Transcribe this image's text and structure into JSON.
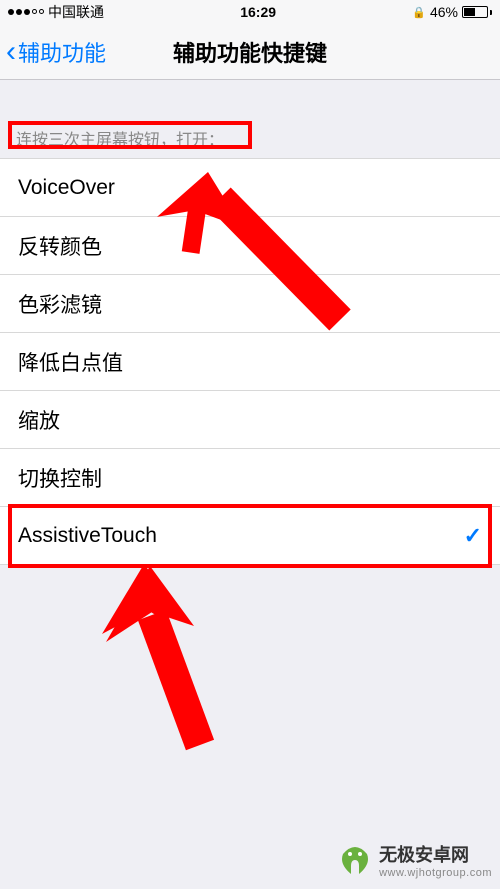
{
  "status_bar": {
    "carrier": "中国联通",
    "time": "16:29",
    "battery_pct": "46%"
  },
  "nav": {
    "back_label": "辅助功能",
    "title": "辅助功能快捷键"
  },
  "section_header": "连按三次主屏幕按钮，打开：",
  "items": [
    {
      "label": "VoiceOver",
      "checked": false
    },
    {
      "label": "反转颜色",
      "checked": false
    },
    {
      "label": "色彩滤镜",
      "checked": false
    },
    {
      "label": "降低白点值",
      "checked": false
    },
    {
      "label": "缩放",
      "checked": false
    },
    {
      "label": "切换控制",
      "checked": false
    },
    {
      "label": "AssistiveTouch",
      "checked": true
    }
  ],
  "watermark": {
    "title": "无极安卓网",
    "url": "www.wjhotgroup.com"
  }
}
